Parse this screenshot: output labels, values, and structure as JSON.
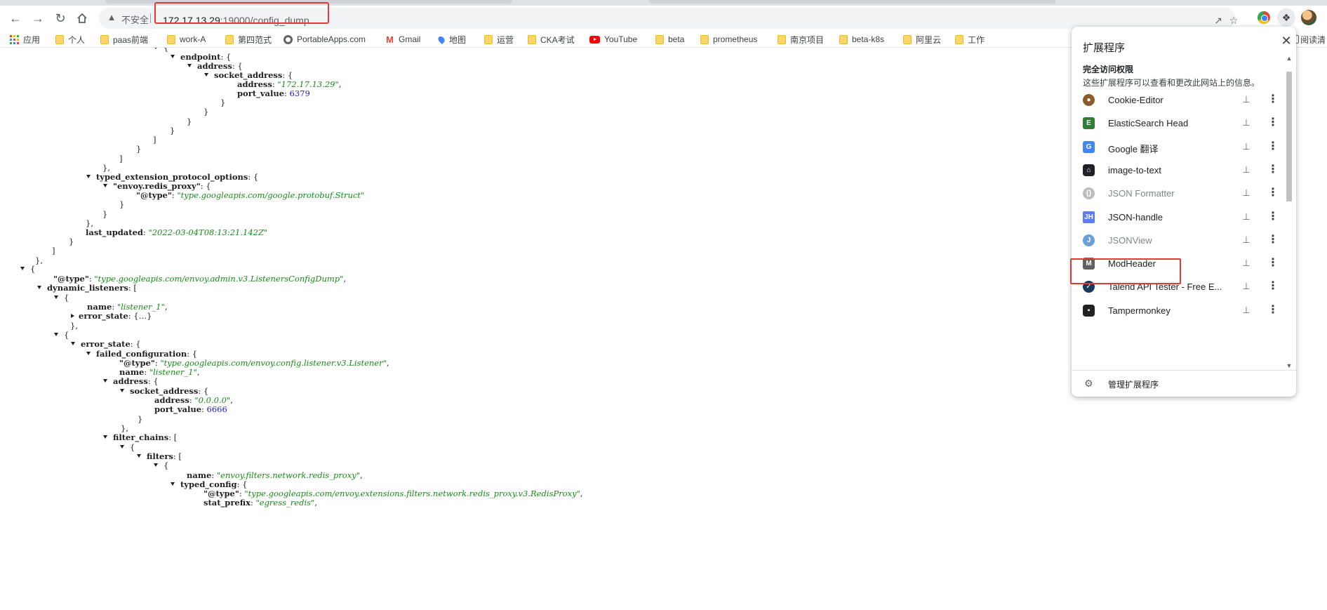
{
  "browser": {
    "security_label": "不安全",
    "url_host": "172.17.13.29",
    "url_path": ":19000/config_dump"
  },
  "bookmarks": [
    {
      "label": "应用",
      "icon": "apps-grid-icon"
    },
    {
      "label": "个人",
      "icon": "folder-icon"
    },
    {
      "label": "paas前端",
      "icon": "folder-icon"
    },
    {
      "label": "work-A",
      "icon": "folder-icon"
    },
    {
      "label": "第四范式",
      "icon": "folder-icon"
    },
    {
      "label": "PortableApps.com",
      "icon": "portableapps-icon"
    },
    {
      "label": "Gmail",
      "icon": "gmail-icon"
    },
    {
      "label": "地图",
      "icon": "maps-pin-icon"
    },
    {
      "label": "运营",
      "icon": "folder-icon"
    },
    {
      "label": "CKA考试",
      "icon": "folder-icon"
    },
    {
      "label": "YouTube",
      "icon": "youtube-icon"
    },
    {
      "label": "beta",
      "icon": "folder-icon"
    },
    {
      "label": "prometheus",
      "icon": "folder-icon"
    },
    {
      "label": "南京项目",
      "icon": "folder-icon"
    },
    {
      "label": "beta-k8s",
      "icon": "folder-icon"
    },
    {
      "label": "阿里云",
      "icon": "folder-icon"
    },
    {
      "label": "工作",
      "icon": "folder-icon"
    }
  ],
  "reading_list_label": "阅读清",
  "json_lines": [
    {
      "toggle": "open",
      "tokens": [
        {
          "t": "p",
          "v": "{"
        }
      ]
    },
    {
      "toggle": "open",
      "tokens": [
        {
          "t": "k",
          "v": "endpoint"
        },
        {
          "t": "p",
          "v": ": {"
        }
      ]
    },
    {
      "toggle": "open",
      "tokens": [
        {
          "t": "k",
          "v": "address"
        },
        {
          "t": "p",
          "v": ": {"
        }
      ]
    },
    {
      "toggle": "open",
      "tokens": [
        {
          "t": "k",
          "v": "socket_address"
        },
        {
          "t": "p",
          "v": ": {"
        }
      ]
    },
    {
      "toggle": "",
      "tokens": [
        {
          "t": "k",
          "v": "address"
        },
        {
          "t": "p",
          "v": ": "
        },
        {
          "t": "s",
          "v": "\"172.17.13.29\""
        },
        {
          "t": "p",
          "v": ","
        }
      ]
    },
    {
      "toggle": "",
      "tokens": [
        {
          "t": "k",
          "v": "port_value"
        },
        {
          "t": "p",
          "v": ": "
        },
        {
          "t": "n",
          "v": "6379"
        }
      ]
    },
    {
      "toggle": "",
      "tokens": [
        {
          "t": "p",
          "v": "}"
        }
      ]
    },
    {
      "toggle": "",
      "tokens": [
        {
          "t": "p",
          "v": "}"
        }
      ]
    },
    {
      "toggle": "",
      "tokens": [
        {
          "t": "p",
          "v": "}"
        }
      ]
    },
    {
      "toggle": "",
      "tokens": [
        {
          "t": "p",
          "v": "}"
        }
      ]
    },
    {
      "toggle": "",
      "tokens": [
        {
          "t": "p",
          "v": "]"
        }
      ]
    },
    {
      "toggle": "",
      "tokens": [
        {
          "t": "p",
          "v": "}"
        }
      ]
    },
    {
      "toggle": "",
      "tokens": [
        {
          "t": "p",
          "v": "]"
        }
      ]
    },
    {
      "toggle": "",
      "tokens": [
        {
          "t": "p",
          "v": "},"
        }
      ]
    },
    {
      "toggle": "open",
      "tokens": [
        {
          "t": "k",
          "v": "typed_extension_protocol_options"
        },
        {
          "t": "p",
          "v": ": {"
        }
      ]
    },
    {
      "toggle": "open",
      "tokens": [
        {
          "t": "k",
          "v": "\"envoy.redis_proxy\""
        },
        {
          "t": "p",
          "v": ": {"
        }
      ]
    },
    {
      "toggle": "",
      "tokens": [
        {
          "t": "k",
          "v": "\"@type\""
        },
        {
          "t": "p",
          "v": ": "
        },
        {
          "t": "s",
          "v": "\"type.googleapis.com/google.protobuf.Struct\""
        }
      ]
    },
    {
      "toggle": "",
      "tokens": [
        {
          "t": "p",
          "v": "}"
        }
      ]
    },
    {
      "toggle": "",
      "tokens": [
        {
          "t": "p",
          "v": "}"
        }
      ]
    },
    {
      "toggle": "",
      "tokens": [
        {
          "t": "p",
          "v": "},"
        }
      ]
    },
    {
      "toggle": "",
      "tokens": [
        {
          "t": "k",
          "v": "last_updated"
        },
        {
          "t": "p",
          "v": ": "
        },
        {
          "t": "s",
          "v": "\"2022-03-04T08:13:21.142Z\""
        }
      ]
    },
    {
      "toggle": "",
      "tokens": [
        {
          "t": "p",
          "v": "}"
        }
      ]
    },
    {
      "toggle": "",
      "tokens": [
        {
          "t": "p",
          "v": "]"
        }
      ]
    },
    {
      "toggle": "",
      "tokens": [
        {
          "t": "p",
          "v": "},"
        }
      ]
    },
    {
      "toggle": "open",
      "tokens": [
        {
          "t": "p",
          "v": "{"
        }
      ]
    },
    {
      "toggle": "",
      "tokens": [
        {
          "t": "k",
          "v": "\"@type\""
        },
        {
          "t": "p",
          "v": ": "
        },
        {
          "t": "s",
          "v": "\"type.googleapis.com/envoy.admin.v3.ListenersConfigDump\""
        },
        {
          "t": "p",
          "v": ","
        }
      ]
    },
    {
      "toggle": "open",
      "tokens": [
        {
          "t": "k",
          "v": "dynamic_listeners"
        },
        {
          "t": "p",
          "v": ": ["
        }
      ]
    },
    {
      "toggle": "open",
      "tokens": [
        {
          "t": "p",
          "v": "{"
        }
      ]
    },
    {
      "toggle": "",
      "tokens": [
        {
          "t": "k",
          "v": "name"
        },
        {
          "t": "p",
          "v": ": "
        },
        {
          "t": "s",
          "v": "\"listener_1\""
        },
        {
          "t": "p",
          "v": ","
        }
      ]
    },
    {
      "toggle": "closed",
      "tokens": [
        {
          "t": "k",
          "v": "error_state"
        },
        {
          "t": "p",
          "v": ": {…}"
        }
      ]
    },
    {
      "toggle": "",
      "tokens": [
        {
          "t": "p",
          "v": "},"
        }
      ]
    },
    {
      "toggle": "open",
      "tokens": [
        {
          "t": "p",
          "v": "{"
        }
      ]
    },
    {
      "toggle": "open",
      "tokens": [
        {
          "t": "k",
          "v": "error_state"
        },
        {
          "t": "p",
          "v": ": {"
        }
      ]
    },
    {
      "toggle": "open",
      "tokens": [
        {
          "t": "k",
          "v": "failed_configuration"
        },
        {
          "t": "p",
          "v": ": {"
        }
      ]
    },
    {
      "toggle": "",
      "tokens": [
        {
          "t": "k",
          "v": "\"@type\""
        },
        {
          "t": "p",
          "v": ": "
        },
        {
          "t": "s",
          "v": "\"type.googleapis.com/envoy.config.listener.v3.Listener\""
        },
        {
          "t": "p",
          "v": ","
        }
      ]
    },
    {
      "toggle": "",
      "tokens": [
        {
          "t": "k",
          "v": "name"
        },
        {
          "t": "p",
          "v": ": "
        },
        {
          "t": "s",
          "v": "\"listener_1\""
        },
        {
          "t": "p",
          "v": ","
        }
      ]
    },
    {
      "toggle": "open",
      "tokens": [
        {
          "t": "k",
          "v": "address"
        },
        {
          "t": "p",
          "v": ": {"
        }
      ]
    },
    {
      "toggle": "open",
      "tokens": [
        {
          "t": "k",
          "v": "socket_address"
        },
        {
          "t": "p",
          "v": ": {"
        }
      ]
    },
    {
      "toggle": "",
      "tokens": [
        {
          "t": "k",
          "v": "address"
        },
        {
          "t": "p",
          "v": ": "
        },
        {
          "t": "s",
          "v": "\"0.0.0.0\""
        },
        {
          "t": "p",
          "v": ","
        }
      ]
    },
    {
      "toggle": "",
      "tokens": [
        {
          "t": "k",
          "v": "port_value"
        },
        {
          "t": "p",
          "v": ": "
        },
        {
          "t": "n",
          "v": "6666"
        }
      ]
    },
    {
      "toggle": "",
      "tokens": [
        {
          "t": "p",
          "v": "}"
        }
      ]
    },
    {
      "toggle": "",
      "tokens": [
        {
          "t": "p",
          "v": "},"
        }
      ]
    },
    {
      "toggle": "open",
      "tokens": [
        {
          "t": "k",
          "v": "filter_chains"
        },
        {
          "t": "p",
          "v": ": ["
        }
      ]
    },
    {
      "toggle": "open",
      "tokens": [
        {
          "t": "p",
          "v": "{"
        }
      ]
    },
    {
      "toggle": "open",
      "tokens": [
        {
          "t": "k",
          "v": "filters"
        },
        {
          "t": "p",
          "v": ": ["
        }
      ]
    },
    {
      "toggle": "open",
      "tokens": [
        {
          "t": "p",
          "v": "{"
        }
      ]
    },
    {
      "toggle": "",
      "tokens": [
        {
          "t": "k",
          "v": "name"
        },
        {
          "t": "p",
          "v": ": "
        },
        {
          "t": "s",
          "v": "\"envoy.filters.network.redis_proxy\""
        },
        {
          "t": "p",
          "v": ","
        }
      ]
    },
    {
      "toggle": "open",
      "tokens": [
        {
          "t": "k",
          "v": "typed_config"
        },
        {
          "t": "p",
          "v": ": {"
        }
      ]
    },
    {
      "toggle": "",
      "tokens": [
        {
          "t": "k",
          "v": "\"@type\""
        },
        {
          "t": "p",
          "v": ": "
        },
        {
          "t": "s",
          "v": "\"type.googleapis.com/envoy.extensions.filters.network.redis_proxy.v3.RedisProxy\""
        },
        {
          "t": "p",
          "v": ","
        }
      ]
    },
    {
      "toggle": "",
      "tokens": [
        {
          "t": "k",
          "v": "stat_prefix"
        },
        {
          "t": "p",
          "v": ": "
        },
        {
          "t": "s",
          "v": "\"egress_redis\""
        },
        {
          "t": "p",
          "v": ","
        }
      ]
    }
  ],
  "extensions_popup": {
    "title": "扩展程序",
    "section_title": "完全访问权限",
    "section_desc": "这些扩展程序可以查看和更改此网站上的信息。",
    "items": [
      {
        "name": "Cookie-Editor",
        "icon": "cookie-icon",
        "dim": false
      },
      {
        "name": "ElasticSearch Head",
        "icon": "elasticsearch-head-icon",
        "dim": false
      },
      {
        "name": "Google 翻译",
        "icon": "google-translate-icon",
        "dim": false
      },
      {
        "name": "image-to-text",
        "icon": "image-to-text-icon",
        "dim": false
      },
      {
        "name": "JSON Formatter",
        "icon": "json-formatter-icon",
        "dim": true
      },
      {
        "name": "JSON-handle",
        "icon": "json-handle-icon",
        "dim": false
      },
      {
        "name": "JSONView",
        "icon": "jsonview-icon",
        "dim": true
      },
      {
        "name": "ModHeader",
        "icon": "modheader-icon",
        "dim": false
      },
      {
        "name": "Talend API Tester - Free E...",
        "icon": "talend-icon",
        "dim": false
      },
      {
        "name": "Tampermonkey",
        "icon": "tampermonkey-icon",
        "dim": false
      }
    ],
    "manage_label": "管理扩展程序"
  }
}
